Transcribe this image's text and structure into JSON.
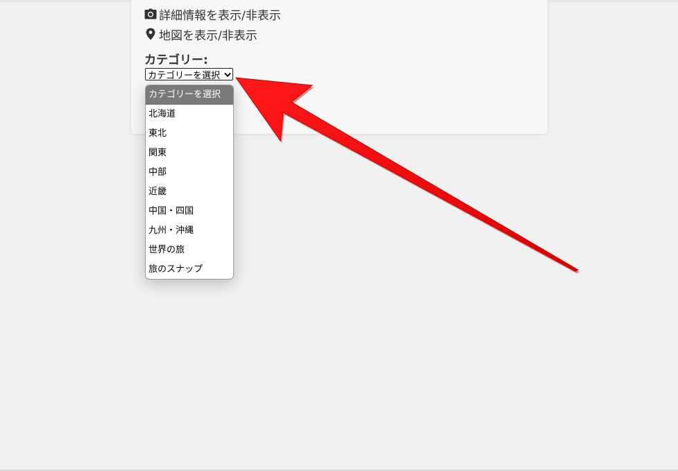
{
  "panel": {
    "toggles": [
      {
        "icon": "camera-icon",
        "label": "詳細情報を表示/非表示"
      },
      {
        "icon": "map-marker-icon",
        "label": "地図を表示/非表示"
      }
    ],
    "category_label": "カテゴリー:",
    "select": {
      "value": "カテゴリーを選択",
      "options": [
        "カテゴリーを選択",
        "北海道",
        "東北",
        "関東",
        "中部",
        "近畿",
        "中国・四国",
        "九州・沖縄",
        "世界の旅",
        "旅のスナップ"
      ],
      "highlighted_index": 0
    }
  },
  "annotation": {
    "arrow_color": "#ff0000",
    "arrow_icon": "red-arrow-pointer"
  }
}
